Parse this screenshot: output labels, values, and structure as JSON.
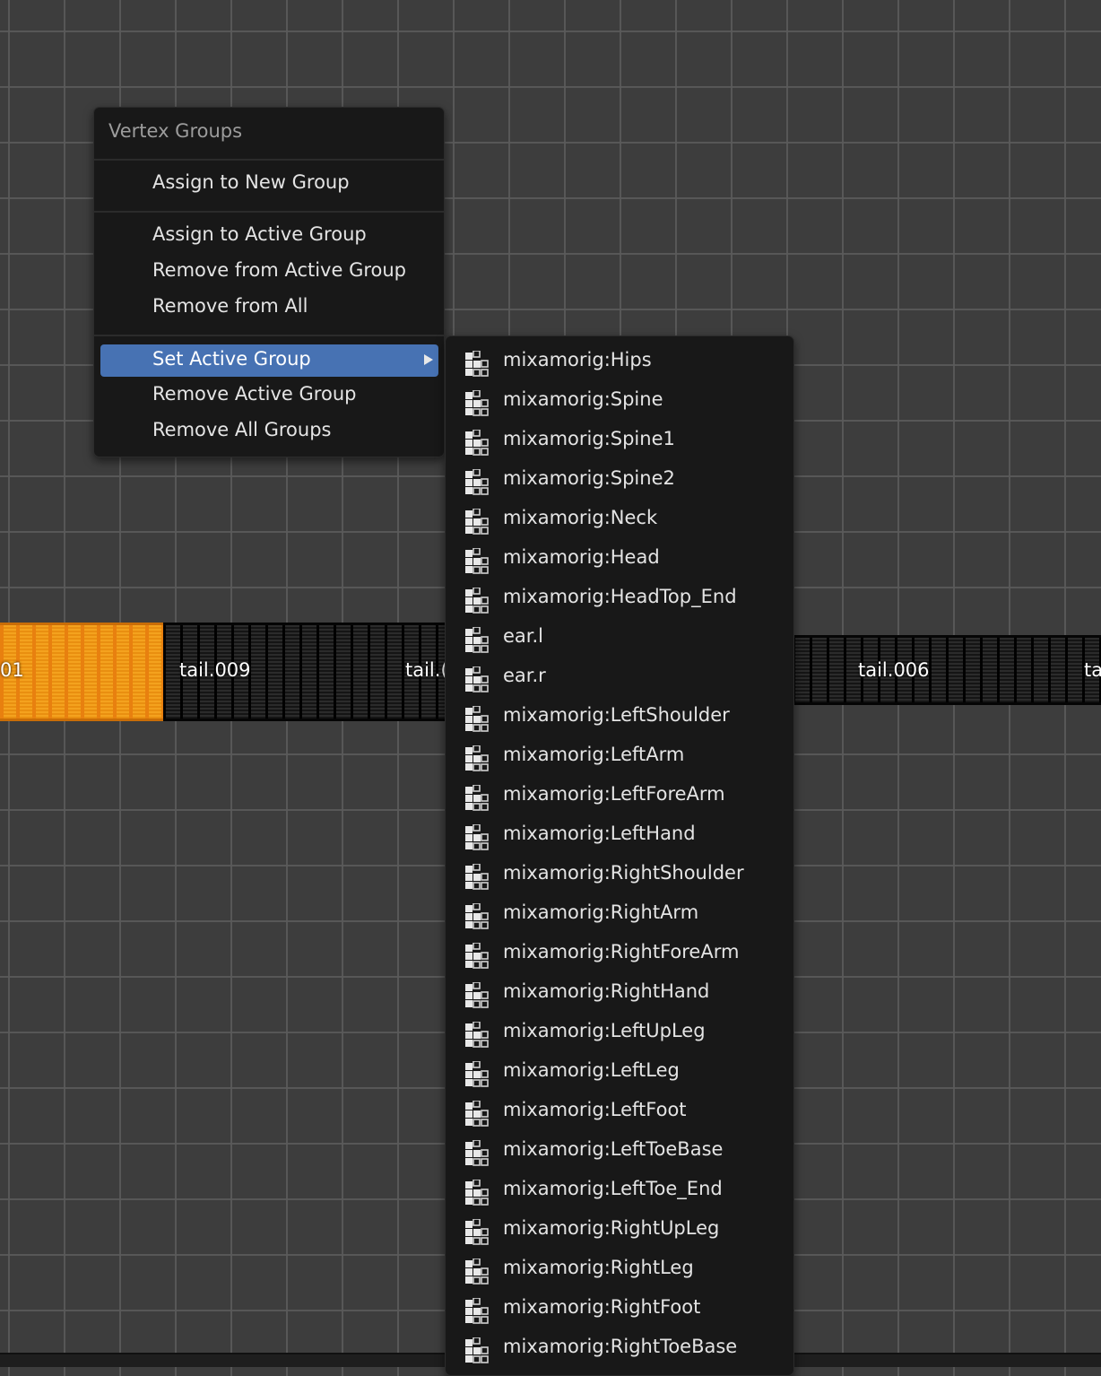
{
  "viewport": {
    "bone_labels": [
      "01",
      "tail.009",
      "tail.(",
      "tail.006",
      "ta"
    ]
  },
  "menu": {
    "title": "Vertex Groups",
    "items": [
      {
        "label": "Assign to New Group"
      },
      {
        "label": "Assign to Active Group"
      },
      {
        "label": "Remove from Active Group"
      },
      {
        "label": "Remove from All"
      },
      {
        "label": "Set Active Group",
        "active": true,
        "has_submenu": true
      },
      {
        "label": "Remove Active Group"
      },
      {
        "label": "Remove All Groups"
      }
    ]
  },
  "submenu": {
    "icon": "vertex-group-icon",
    "items": [
      "mixamorig:Hips",
      "mixamorig:Spine",
      "mixamorig:Spine1",
      "mixamorig:Spine2",
      "mixamorig:Neck",
      "mixamorig:Head",
      "mixamorig:HeadTop_End",
      "ear.l",
      "ear.r",
      "mixamorig:LeftShoulder",
      "mixamorig:LeftArm",
      "mixamorig:LeftForeArm",
      "mixamorig:LeftHand",
      "mixamorig:RightShoulder",
      "mixamorig:RightArm",
      "mixamorig:RightForeArm",
      "mixamorig:RightHand",
      "mixamorig:LeftUpLeg",
      "mixamorig:LeftLeg",
      "mixamorig:LeftFoot",
      "mixamorig:LeftToeBase",
      "mixamorig:LeftToe_End",
      "mixamorig:RightUpLeg",
      "mixamorig:RightLeg",
      "mixamorig:RightFoot",
      "mixamorig:RightToeBase"
    ]
  },
  "colors": {
    "background": "#3d3d3d",
    "menu_background": "#181818",
    "highlight": "#4772b3",
    "selected_bone": "#f4a21e"
  }
}
